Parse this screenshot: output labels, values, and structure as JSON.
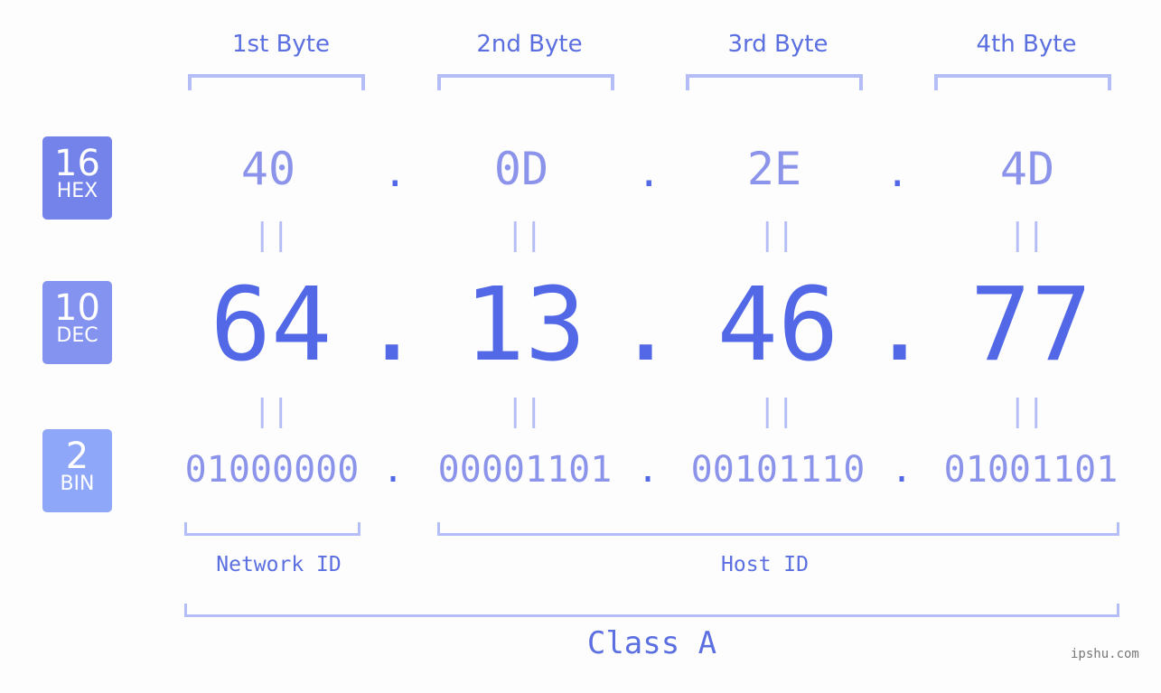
{
  "badges": [
    {
      "num": "16",
      "label": "HEX",
      "color": "#7483ea"
    },
    {
      "num": "10",
      "label": "DEC",
      "color": "#8493f0"
    },
    {
      "num": "2",
      "label": "BIN",
      "color": "#8fa7f8"
    }
  ],
  "headers": [
    "1st Byte",
    "2nd Byte",
    "3rd Byte",
    "4th Byte"
  ],
  "hex": [
    "40",
    "0D",
    "2E",
    "4D"
  ],
  "dec": [
    "64",
    "13",
    "46",
    "77"
  ],
  "bin": [
    "01000000",
    "00001101",
    "00101110",
    "01001101"
  ],
  "separator": ".",
  "equals": "||",
  "network_label": "Network ID",
  "host_label": "Host ID",
  "class_label": "Class A",
  "watermark": "ipshu.com"
}
